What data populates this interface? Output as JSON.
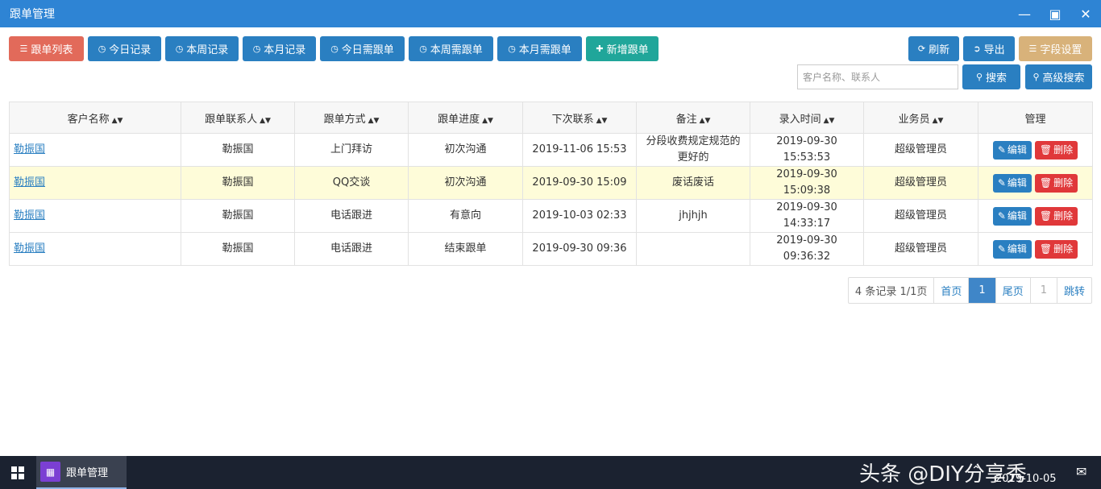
{
  "window": {
    "title": "跟单管理"
  },
  "toolbar": {
    "list": "跟单列表",
    "today": "今日记录",
    "week": "本周记录",
    "month": "本月记录",
    "today_due": "今日需跟单",
    "week_due": "本周需跟单",
    "month_due": "本月需跟单",
    "add": "新增跟单",
    "refresh": "刷新",
    "export": "导出",
    "fields": "字段设置"
  },
  "search": {
    "placeholder": "客户名称、联系人",
    "search_label": "搜索",
    "advanced_label": "高级搜索"
  },
  "table": {
    "headers": [
      "客户名称",
      "跟单联系人",
      "跟单方式",
      "跟单进度",
      "下次联系",
      "备注",
      "录入时间",
      "业务员",
      "管理"
    ],
    "rows": [
      {
        "customer": "勒振国",
        "contact": "勒振国",
        "method": "上门拜访",
        "progress": "初次沟通",
        "next": "2019-11-06 15:53",
        "note": "分段收费规定规范的更好的",
        "entered": "2019-09-30 15:53:53",
        "staff": "超级管理员"
      },
      {
        "customer": "勒振国",
        "contact": "勒振国",
        "method": "QQ交谈",
        "progress": "初次沟通",
        "next": "2019-09-30 15:09",
        "note": "废话废话",
        "entered": "2019-09-30 15:09:38",
        "staff": "超级管理员"
      },
      {
        "customer": "勒振国",
        "contact": "勒振国",
        "method": "电话跟进",
        "progress": "有意向",
        "next": "2019-10-03 02:33",
        "note": "jhjhjh",
        "entered": "2019-09-30 14:33:17",
        "staff": "超级管理员"
      },
      {
        "customer": "勒振国",
        "contact": "勒振国",
        "method": "电话跟进",
        "progress": "结束跟单",
        "next": "2019-09-30 09:36",
        "note": "",
        "entered": "2019-09-30 09:36:32",
        "staff": "超级管理员"
      }
    ],
    "edit_label": "编辑",
    "delete_label": "删除"
  },
  "pager": {
    "summary": "4 条记录 1/1页",
    "first": "首页",
    "current": "1",
    "last": "尾页",
    "jump_value": "1",
    "jump": "跳转"
  },
  "taskbar": {
    "app_label": "跟单管理",
    "watermark": "头条 @DIY分享秀",
    "date": "2019-10-05"
  },
  "colors": {
    "titlebar": "#2e84d4",
    "primary": "#2a7fc1",
    "danger": "#e0383a",
    "list_button": "#e26a5a",
    "add_button": "#20a69a",
    "field_button": "#d8b27a",
    "highlight_row": "#fefcd9"
  }
}
